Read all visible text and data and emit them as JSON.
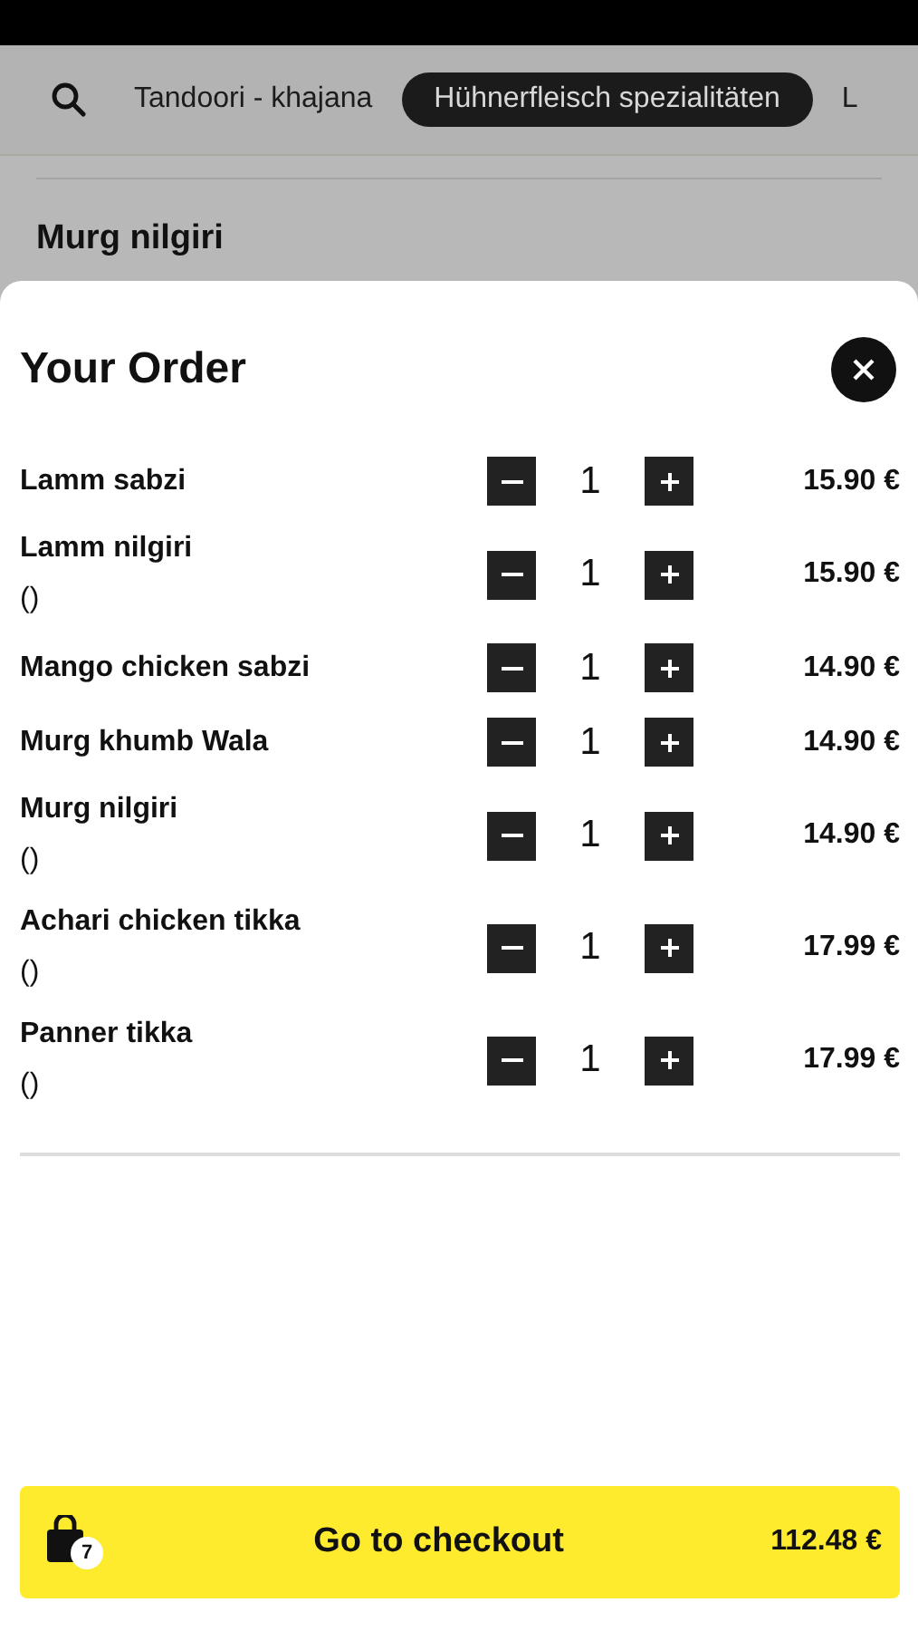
{
  "category_bar": {
    "tabs": [
      {
        "label": "Tandoori - khajana",
        "selected": false
      },
      {
        "label": "Hühnerfleisch spezialitäten",
        "selected": true
      },
      {
        "label": "L",
        "selected": false
      }
    ]
  },
  "background": {
    "item_name": "Murg nilgiri"
  },
  "order": {
    "title": "Your Order",
    "items": [
      {
        "name": "Lamm sabzi",
        "quantity": "1",
        "price": "15.90 €"
      },
      {
        "name": "Lamm nilgiri",
        "note": "()",
        "quantity": "1",
        "price": "15.90 €"
      },
      {
        "name": "Mango chicken sabzi",
        "quantity": "1",
        "price": "14.90 €"
      },
      {
        "name": "Murg khumb Wala",
        "quantity": "1",
        "price": "14.90 €"
      },
      {
        "name": "Murg nilgiri",
        "note": "()",
        "quantity": "1",
        "price": "14.90 €"
      },
      {
        "name": "Achari chicken tikka",
        "note": "()",
        "quantity": "1",
        "price": "17.99 €"
      },
      {
        "name": "Panner tikka",
        "note": "()",
        "quantity": "1",
        "price": "17.99 €"
      }
    ],
    "checkout": {
      "label": "Go to checkout",
      "count": "7",
      "total": "112.48 €"
    }
  }
}
